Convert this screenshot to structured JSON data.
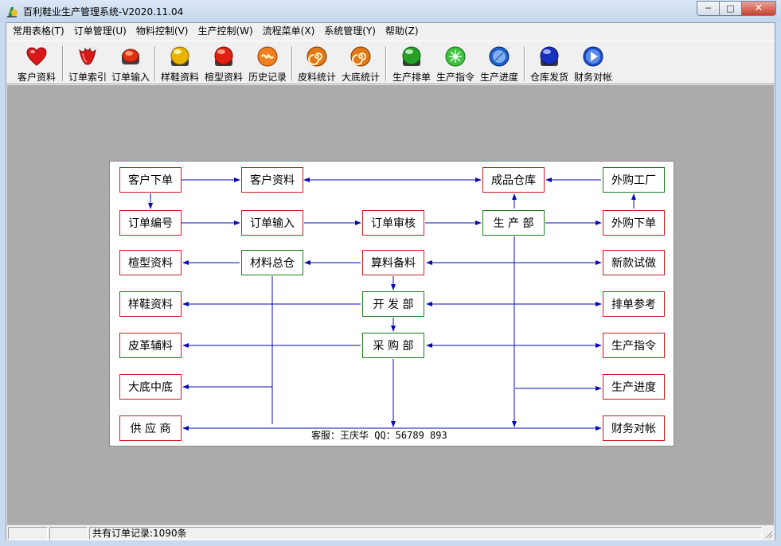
{
  "window": {
    "title": "百利鞋业生产管理系统-V2020.11.04",
    "minimize": "─",
    "maximize": "□",
    "close": "✕"
  },
  "menu": [
    "常用表格(T)",
    "订单管理(U)",
    "物料控制(V)",
    "生产控制(W)",
    "流程菜单(X)",
    "系统管理(Y)",
    "帮助(Z)"
  ],
  "toolbar": [
    {
      "label": "客户资料",
      "icon": "heart-icon",
      "color": "#d81818"
    },
    {
      "label": "订单索引",
      "icon": "tulip-icon",
      "color": "#d81818"
    },
    {
      "label": "订单输入",
      "icon": "red-button-icon",
      "color": "#e03010"
    },
    {
      "label": "样鞋资料",
      "icon": "yellow-orb-icon",
      "color": "#e8b400"
    },
    {
      "label": "楦型资料",
      "icon": "red-orb-icon",
      "color": "#e02010"
    },
    {
      "label": "历史记录",
      "icon": "orange-knot-icon",
      "color": "#f08020"
    },
    {
      "label": "皮料统计",
      "icon": "spiral-icon",
      "color": "#e07818"
    },
    {
      "label": "大底统计",
      "icon": "spiral-icon",
      "color": "#e07818"
    },
    {
      "label": "生产排单",
      "icon": "green-orb-icon",
      "color": "#28a028"
    },
    {
      "label": "生产指令",
      "icon": "green-flower-icon",
      "color": "#40c040"
    },
    {
      "label": "生产进度",
      "icon": "blue-compass-icon",
      "color": "#2060c8"
    },
    {
      "label": "仓库发货",
      "icon": "blue-orb-icon",
      "color": "#1830c0"
    },
    {
      "label": "财务对帐",
      "icon": "play-icon",
      "color": "#1850d0"
    }
  ],
  "flow": {
    "boxes": {
      "kehu_xiadan": "客户下单",
      "kehu_ziliao": "客户资料",
      "chengpin_cangku": "成品仓库",
      "waigou_gongchang": "外购工厂",
      "dingdan_bianhao": "订单编号",
      "dingdan_shuru": "订单输入",
      "dingdan_shenhe": "订单审核",
      "shengchan_bu": "生 产 部",
      "waigou_xiadan": "外购下单",
      "xuanxing_ziliao": "楦型资料",
      "cailiao_zongcang": "材料总仓",
      "suanliao_beiliao": "算料备料",
      "xinkuan_shizuo": "新款试做",
      "yangxie_ziliao": "样鞋资料",
      "kaifa_bu": "开 发 部",
      "paidan_cankao": "排单参考",
      "pige_fuliao": "皮革辅料",
      "caigou_bu": "采 购 部",
      "shengchan_zhiling": "生产指令",
      "dadi_zhongdi": "大底中底",
      "shengchan_jindu": "生产进度",
      "gongying_shang": "供 应 商",
      "caiwu_duizhang": "财务对帐"
    },
    "service": "客服：王庆华 QQ：56789 893",
    "line_color": "#0a0ab4"
  },
  "status": {
    "cell1": "",
    "cell2": "",
    "records": "共有订单记录:1090条"
  }
}
